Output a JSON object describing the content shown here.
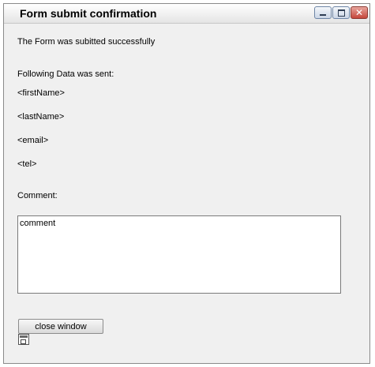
{
  "window": {
    "title": "Form submit confirmation",
    "minimize_symbol": "_",
    "maximize_symbol": "□",
    "close_symbol": "✕"
  },
  "content": {
    "success_message": "The Form was subitted successfully",
    "data_heading": "Following Data was sent:",
    "fields": {
      "first_name": "<firstName>",
      "last_name": "<lastName>",
      "email": "<email>",
      "tel": "<tel>"
    },
    "comment_label": "Comment:",
    "comment_value": "comment"
  },
  "actions": {
    "close_label": "close window"
  },
  "icons": {
    "minimize": "minimize-icon",
    "maximize": "maximize-icon",
    "close": "close-icon",
    "form": "form-icon"
  },
  "colors": {
    "window_bg": "#f0f0f0",
    "close_button": "#c5463a"
  }
}
